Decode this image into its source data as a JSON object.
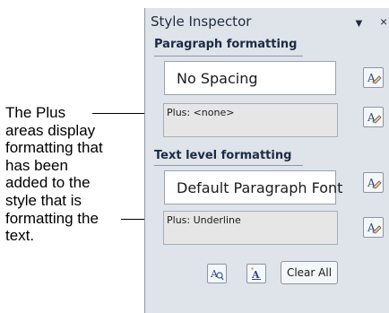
{
  "callout": {
    "lines": [
      "The Plus",
      "areas display",
      "formatting that",
      "has been",
      "added to the",
      "style that is",
      "formatting the",
      "text."
    ]
  },
  "panel": {
    "title": "Style Inspector",
    "dropdown_glyph": "▼",
    "close_glyph": "×"
  },
  "paragraph": {
    "heading": "Paragraph formatting",
    "style_name": "No Spacing",
    "plus_text": "Plus: <none>"
  },
  "text_level": {
    "heading": "Text level formatting",
    "style_name": "Default Paragraph Font",
    "plus_text": "Plus: Underline"
  },
  "buttons": {
    "clear_all": "Clear All",
    "icons": [
      "reveal-formatting-icon",
      "new-style-icon",
      "manage-styles-icon"
    ]
  }
}
